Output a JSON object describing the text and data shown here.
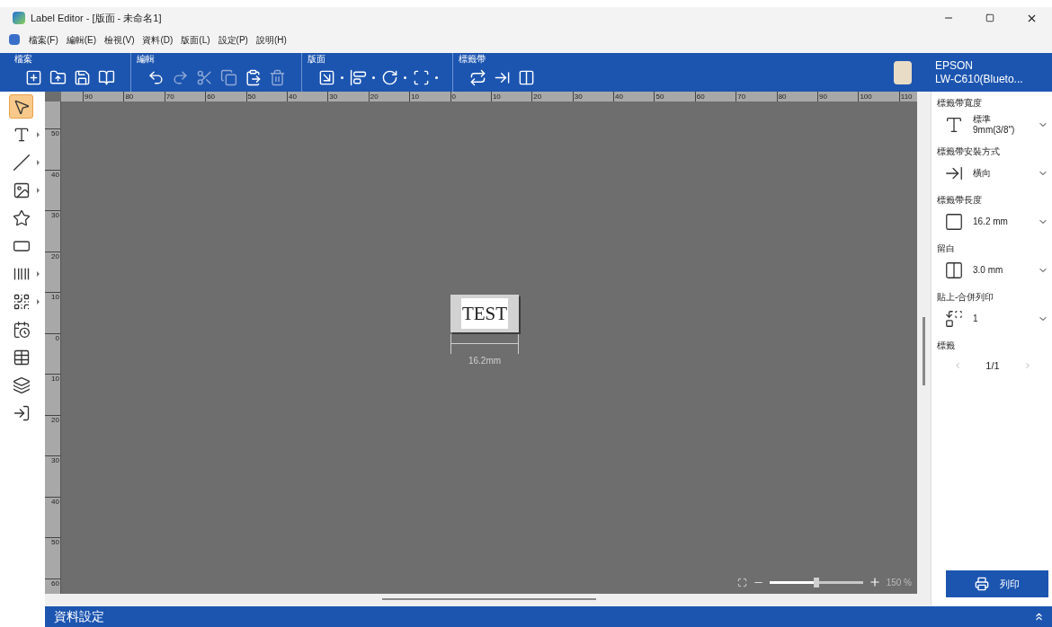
{
  "window": {
    "title": "Label Editor - [版面  - 未命名1]"
  },
  "menu": [
    "檔案(F)",
    "編輯(E)",
    "檢視(V)",
    "資料(D)",
    "版面(L)",
    "設定(P)",
    "說明(H)"
  ],
  "ribbon": [
    {
      "label": "檔案",
      "tools": [
        {
          "disabled": false
        },
        {
          "disabled": false
        },
        {
          "disabled": false
        },
        {
          "disabled": false
        }
      ]
    },
    {
      "label": "編輯",
      "tools": [
        {
          "disabled": false
        },
        {
          "disabled": true
        },
        {
          "disabled": true
        },
        {
          "disabled": true
        },
        {
          "disabled": false
        },
        {
          "disabled": true
        }
      ]
    },
    {
      "label": "版面",
      "tools": [
        {
          "disabled": false
        },
        {
          "disabled": false
        },
        {
          "disabled": false
        },
        {
          "disabled": false
        }
      ]
    },
    {
      "label": "標籤帶",
      "tools": [
        {
          "disabled": false
        },
        {
          "disabled": false
        },
        {
          "disabled": false
        }
      ]
    }
  ],
  "printer": {
    "brand": "EPSON",
    "model": "LW-C610(Blueto..."
  },
  "tools": [
    {
      "selected": true,
      "submenu": false
    },
    {
      "selected": false,
      "submenu": true
    },
    {
      "selected": false,
      "submenu": true
    },
    {
      "selected": false,
      "submenu": true
    },
    {
      "selected": false,
      "submenu": false
    },
    {
      "selected": false,
      "submenu": false
    },
    {
      "selected": false,
      "submenu": true
    },
    {
      "selected": false,
      "submenu": true
    },
    {
      "selected": false,
      "submenu": false
    },
    {
      "selected": false,
      "submenu": false
    },
    {
      "selected": false,
      "submenu": false
    },
    {
      "selected": false,
      "submenu": false
    }
  ],
  "ruler_h": [
    "90",
    "80",
    "70",
    "60",
    "50",
    "40",
    "30",
    "20",
    "10",
    "0",
    "10",
    "20",
    "30",
    "40",
    "50",
    "60",
    "70",
    "80",
    "90",
    "100",
    "110"
  ],
  "ruler_v": [
    "50",
    "40",
    "30",
    "20",
    "10",
    "0",
    "10",
    "20",
    "30",
    "40",
    "50",
    "60"
  ],
  "label": {
    "text": "TEST",
    "length": "16.2mm"
  },
  "zoom": {
    "level": 0.5,
    "reading": "150 %"
  },
  "settings": [
    {
      "label": "標籤帶寬度",
      "values": [
        "標準",
        "9mm(3/8\")"
      ]
    },
    {
      "label": "標籤帶安裝方式",
      "values": [
        "橫向"
      ]
    },
    {
      "label": "標籤帶長度",
      "values": [
        "16.2 mm"
      ]
    },
    {
      "label": "留白",
      "values": [
        "3.0 mm"
      ]
    },
    {
      "label": "貼上-合併列印",
      "values": [
        "1"
      ]
    }
  ],
  "pages": {
    "label": "標籤",
    "reading": "1/1"
  },
  "print_button": "列印",
  "bottom_bar": {
    "title": "資料設定"
  }
}
